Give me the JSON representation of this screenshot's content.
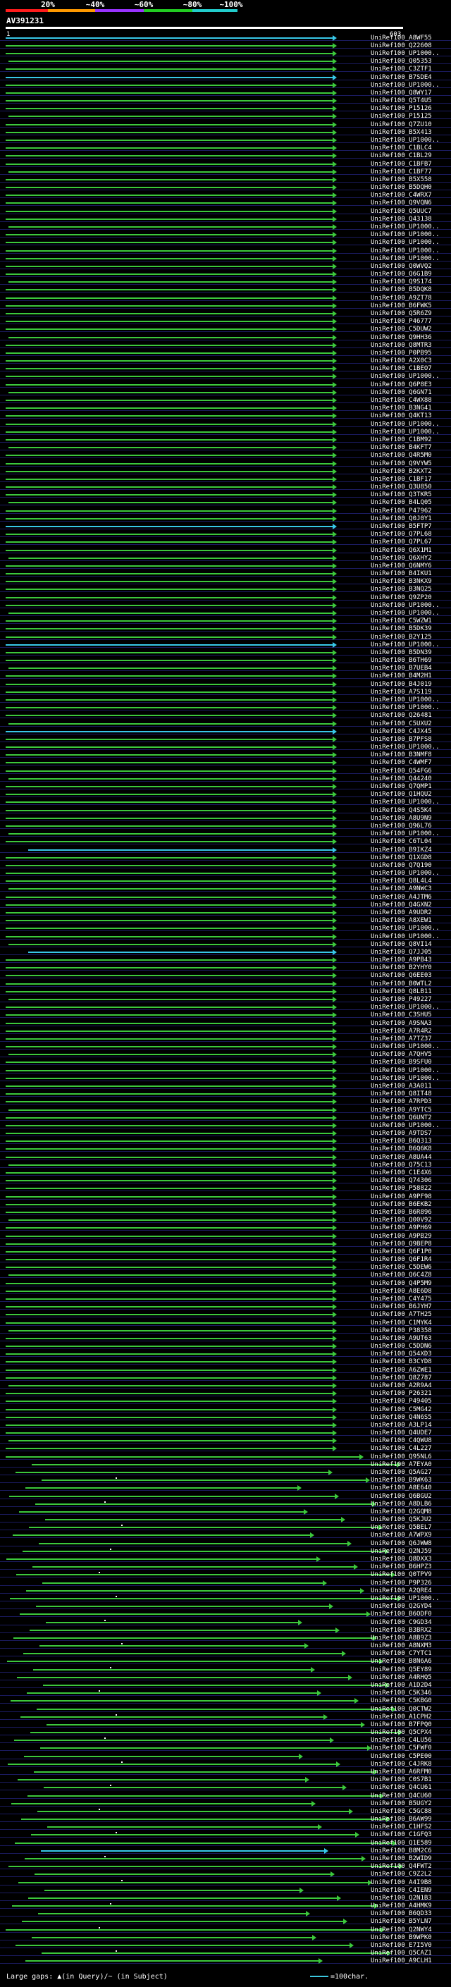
{
  "legend": {
    "marks": [
      "20%",
      "~40%",
      "~60%",
      "~80%",
      "~100%"
    ],
    "colors": [
      "#ff1c1c",
      "#ff9900",
      "#9933ff",
      "#22cc22",
      "#22cccc"
    ]
  },
  "query": {
    "name": "AV391231",
    "start": "1",
    "end": "603"
  },
  "footer": {
    "gaps": "Large gaps: ▲(in Query)/~ (in Subject)",
    "scale": "=100char."
  },
  "hits": {
    "labels": [
      "UniRef100_A8WF55",
      "UniRef100_Q22608",
      "UniRef100_UP1000..",
      "UniRef100_Q05353",
      "UniRef100_C3ZTF1",
      "UniRef100_B7SDE4",
      "UniRef100_UP1000..",
      "UniRef100_Q8WY17",
      "UniRef100_Q5T4U5",
      "UniRef100_P15126",
      "UniRef100_P15125",
      "UniRef100_Q7ZU10",
      "UniRef100_B5X413",
      "UniRef100_UP1000..",
      "UniRef100_C1BLC4",
      "UniRef100_C1BL29",
      "UniRef100_C1BFB7",
      "UniRef100_C1BF77",
      "UniRef100_B5X558",
      "UniRef100_B5DQH0",
      "UniRef100_C4WRX7",
      "UniRef100_Q9VQN6",
      "UniRef100_Q5UUC7",
      "UniRef100_Q43138",
      "UniRef100_UP1000..",
      "UniRef100_UP1000..",
      "UniRef100_UP1000..",
      "UniRef100_UP1000..",
      "UniRef100_UP1000..",
      "UniRef100_Q0WVQ2",
      "UniRef100_Q6G1B9",
      "UniRef100_Q9S174",
      "UniRef100_B5DQK8",
      "UniRef100_A9ZT78",
      "UniRef100_B6FWK5",
      "UniRef100_Q5R6Z9",
      "UniRef100_P46777",
      "UniRef100_C5DUW2",
      "UniRef100_Q9HH36",
      "UniRef100_Q8MTR3",
      "UniRef100_P0PB95",
      "UniRef100_A2X0C3",
      "UniRef100_C1BEO7",
      "UniRef100_UP1000..",
      "UniRef100_Q6P8E3",
      "UniRef100_Q6GN71",
      "UniRef100_C4WX88",
      "UniRef100_B3NG41",
      "UniRef100_Q4KT13",
      "UniRef100_UP1000..",
      "UniRef100_UP1000..",
      "UniRef100_C1BM92",
      "UniRef100_B4KFT7",
      "UniRef100_Q4R5M0",
      "UniRef100_Q9VYW5",
      "UniRef100_B2KXT2",
      "UniRef100_C1BF17",
      "UniRef100_Q3U850",
      "UniRef100_Q3TKR5",
      "UniRef100_B4LQ05",
      "UniRef100_P47962",
      "UniRef100_Q0J0Y1",
      "UniRef100_B5FTP7",
      "UniRef100_Q7PL68",
      "UniRef100_Q7PL67",
      "UniRef100_Q6X1M1",
      "UniRef100_Q6XHY2",
      "UniRef100_Q6NMY6",
      "UniRef100_B4IKU1",
      "UniRef100_B3NKX9",
      "UniRef100_B3NQ25",
      "UniRef100_Q9ZP20",
      "UniRef100_UP1000..",
      "UniRef100_UP1000..",
      "UniRef100_C5WZW1",
      "UniRef100_B5DK39",
      "UniRef100_B2Y125",
      "UniRef100_UP1000..",
      "UniRef100_B5DN39",
      "UniRef100_B6TH69",
      "UniRef100_B7UEB4",
      "UniRef100_B4M2H1",
      "UniRef100_B4J019",
      "UniRef100_A7S119",
      "UniRef100_UP1000..",
      "UniRef100_UP1000..",
      "UniRef100_Q26481",
      "UniRef100_C5UXU2",
      "UniRef100_C4JX45",
      "UniRef100_B7PFS8",
      "UniRef100_UP1000..",
      "UniRef100_B3NMF8",
      "UniRef100_C4WMF7",
      "UniRef100_Q54FG6",
      "UniRef100_Q44240",
      "UniRef100_Q7QMP1",
      "UniRef100_Q1HQU2",
      "UniRef100_UP1000..",
      "UniRef100_Q4S5K4",
      "UniRef100_A8U9N9",
      "UniRef100_Q96L76",
      "UniRef100_UP1000..",
      "UniRef100_C6TL04",
      "UniRef100_B9IKZ4",
      "UniRef100_Q1XGD8",
      "UniRef100_Q7Q190",
      "UniRef100_UP1000..",
      "UniRef100_Q8L4L4",
      "UniRef100_A9NWC3",
      "UniRef100_A4JTM6",
      "UniRef100_Q4GXN2",
      "UniRef100_A9UDR2",
      "UniRef100_A8XEW1",
      "UniRef100_UP1000..",
      "UniRef100_UP1000..",
      "UniRef100_Q8VI14",
      "UniRef100_Q7JJ05",
      "UniRef100_A9PB43",
      "UniRef100_B2YHY0",
      "UniRef100_Q6EE03",
      "UniRef100_B0WTL2",
      "UniRef100_Q8LB11",
      "UniRef100_P49227",
      "UniRef100_UP1000..",
      "UniRef100_C3SHU5",
      "UniRef100_A9SNA3",
      "UniRef100_A7R4R2",
      "UniRef100_A7TZ37",
      "UniRef100_UP1000..",
      "UniRef100_A7QHV5",
      "UniRef100_B9SFU0",
      "UniRef100_UP1000..",
      "UniRef100_UP1000..",
      "UniRef100_A3A011",
      "UniRef100_Q8IT48",
      "UniRef100_A7RPD3",
      "UniRef100_A9YTC5",
      "UniRef100_Q6UNT2",
      "UniRef100_UP1000..",
      "UniRef100_A9TDS7",
      "UniRef100_B6Q313",
      "UniRef100_B6Q6K8",
      "UniRef100_A8UA44",
      "UniRef100_Q75C13",
      "UniRef100_C1E4X6",
      "UniRef100_Q74306",
      "UniRef100_P58822",
      "UniRef100_A9PF98",
      "UniRef100_B6EKB2",
      "UniRef100_B6R896",
      "UniRef100_Q00V92",
      "UniRef100_A9PH69",
      "UniRef100_A9PB29",
      "UniRef100_Q9BEP8",
      "UniRef100_Q6F1P0",
      "UniRef100_Q6F1R4",
      "UniRef100_C5DEW6",
      "UniRef100_Q6C4Z8",
      "UniRef100_Q4P5M9",
      "UniRef100_A8E6D8",
      "UniRef100_C4Y475",
      "UniRef100_B6JYH7",
      "UniRef100_A7TH25",
      "UniRef100_C1MYK4",
      "UniRef100_P38358",
      "UniRef100_A9UT63",
      "UniRef100_C5DDN6",
      "UniRef100_Q54XD3",
      "UniRef100_B3CYD8",
      "UniRef100_A6ZWE1",
      "UniRef100_Q8Z787",
      "UniRef100_A2R9A4",
      "UniRef100_P26321",
      "UniRef100_P49405",
      "UniRef100_C5MG42",
      "UniRef100_Q4N6S5",
      "UniRef100_A3LP14",
      "UniRef100_Q4UDE7",
      "UniRef100_C4QWU8",
      "UniRef100_C4L227",
      "UniRef100_Q95NL6",
      "UniRef100_A7EYA0",
      "UniRef100_Q5AG27",
      "UniRef100_B9WK63",
      "UniRef100_A8E640",
      "UniRef100_Q6BGU2",
      "UniRef100_A8DLB6",
      "UniRef100_Q2GQM8",
      "UniRef100_Q5KJU2",
      "UniRef100_Q5BEL7",
      "UniRef100_A7WPX9",
      "UniRef100_Q6JWW8",
      "UniRef100_Q2NJ59",
      "UniRef100_Q8DXX3",
      "UniRef100_B6HPZ3",
      "UniRef100_Q0TPV9",
      "UniRef100_P9P326",
      "UniRef100_A2QRE4",
      "UniRef100_UP1000..",
      "UniRef100_Q2GYD4",
      "UniRef100_B6ODF0",
      "UniRef100_C9GD34",
      "UniRef100_B3BRX2",
      "UniRef100_A8B9Z3",
      "UniRef100_A8NXM3",
      "UniRef100_C7YTC1",
      "UniRef100_B8N6A6",
      "UniRef100_Q5EY89",
      "UniRef100_A4RHQ5",
      "UniRef100_A1D2D4",
      "UniRef100_C5K346",
      "UniRef100_C5KBG0",
      "UniRef100_Q0CTW2",
      "UniRef100_A1CPH2",
      "UniRef100_B7FPQ0",
      "UniRef100_Q5CPX4",
      "UniRef100_C4LU56",
      "UniRef100_C5FWF0",
      "UniRef100_C5PE00",
      "UniRef100_C4JRK8",
      "UniRef100_A6RFM0",
      "UniRef100_C0S7B1",
      "UniRef100_Q4CU61",
      "UniRef100_Q4CU60",
      "UniRef100_B5UGY2",
      "UniRef100_C5GC88",
      "UniRef100_B6AW99",
      "UniRef100_C1HFS2",
      "UniRef100_C1GFQ3",
      "UniRef100_Q1E589",
      "UniRef100_B8M2C6",
      "UniRef100_B2WID9",
      "UniRef100_Q4FWT2",
      "UniRef100_C9Z2L2",
      "UniRef100_A4I9B8",
      "UniRef100_C4IEN9",
      "UniRef100_Q2N1B3",
      "UniRef100_A4HMK9",
      "UniRef100_B6QD33",
      "UniRef100_B5YLN7",
      "UniRef100_Q2NWY4",
      "UniRef100_B9WPK0",
      "UniRef100_E7I5V0",
      "UniRef100_Q5CAZ1",
      "UniRef100_A9CLH1"
    ]
  }
}
